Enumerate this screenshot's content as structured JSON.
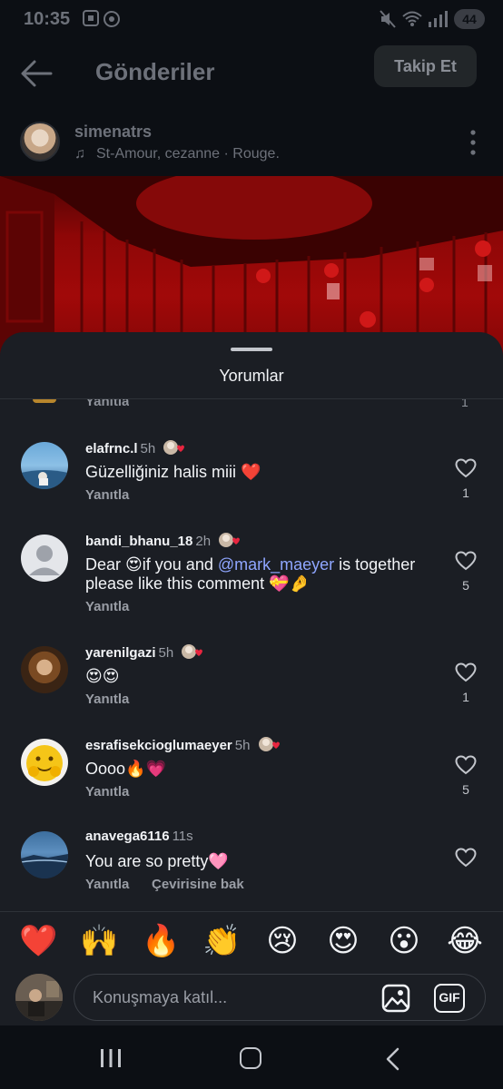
{
  "status_bar": {
    "time": "10:35",
    "battery": "44"
  },
  "header": {
    "title": "Gönderiler",
    "follow_label": "Takip Et"
  },
  "post": {
    "username": "simenatrs",
    "music": "St-Amour, cezanne · Rouge."
  },
  "sheet": {
    "title": "Yorumlar"
  },
  "partial_comment": {
    "reply_label": "Yanıtla",
    "likes": "1"
  },
  "comments": [
    {
      "username": "elafrnc.l",
      "time": "5h",
      "text": "Güzelliğiniz halis miii ❤️",
      "reply_label": "Yanıtla",
      "likes": "1"
    },
    {
      "username": "bandi_bhanu_18",
      "time": "2h",
      "text_before": "Dear 😍if you and ",
      "mention": "@mark_maeyer",
      "text_after": " is together please like this comment 💝🤌",
      "reply_label": "Yanıtla",
      "likes": "5"
    },
    {
      "username": "yarenilgazi",
      "time": "5h",
      "text": "😍😍",
      "reply_label": "Yanıtla",
      "likes": "1"
    },
    {
      "username": "esrafisekcioglumaeyer",
      "time": "5h",
      "text": "Oooo🔥💗",
      "reply_label": "Yanıtla",
      "likes": "5"
    },
    {
      "username": "anavega6116",
      "time": "11s",
      "text": "You are so pretty🩷",
      "reply_label": "Yanıtla",
      "translate_label": "Çevirisine bak",
      "likes": ""
    }
  ],
  "emoji_bar": [
    "❤️",
    "🙌",
    "🔥",
    "👏",
    "😢",
    "😍",
    "😮",
    "😂"
  ],
  "input": {
    "placeholder": "Konuşmaya katıl...",
    "gif_label": "GIF"
  },
  "icons": {
    "back": "back-arrow-icon",
    "more": "more-vertical-icon",
    "music": "music-note-icon",
    "heart": "heart-outline-icon",
    "image": "image-icon",
    "gif": "gif-icon"
  },
  "colors": {
    "background": "#0c0f14",
    "sheet": "#1b1e24",
    "mention": "#8fa6ff",
    "muted": "#9a9ea6",
    "heart_red": "#e8253f"
  }
}
